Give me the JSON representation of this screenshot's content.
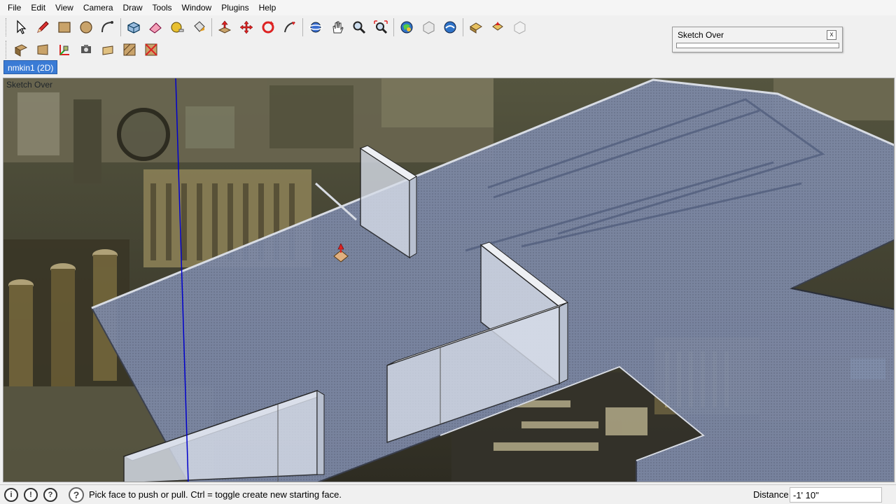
{
  "menu": {
    "items": [
      "File",
      "Edit",
      "View",
      "Camera",
      "Draw",
      "Tools",
      "Window",
      "Plugins",
      "Help"
    ]
  },
  "toolbar1": {
    "groups": [
      [
        "select-tool",
        "pencil-tool",
        "rectangle-tool",
        "circle-tool",
        "arc-tool"
      ],
      [
        "make-component-tool",
        "eraser-tool",
        "tape-measure-tool",
        "paint-bucket-tool"
      ],
      [
        "push-pull-tool",
        "move-tool",
        "rotate-tool",
        "follow-me-tool"
      ],
      [
        "orbit-tool",
        "pan-tool",
        "zoom-tool",
        "zoom-extents-tool"
      ],
      [
        "get-models-tool",
        "share-model-tool",
        "share-component-tool"
      ],
      [
        "walk-tool",
        "look-around-tool",
        "position-camera-tool"
      ]
    ]
  },
  "toolbar2": {
    "items": [
      "position-texture-tool",
      "project-texture-tool",
      "axes-tool",
      "camera-match-tool",
      "plane-tool",
      "hatch-tool",
      "remove-texture-tool"
    ]
  },
  "scene_tab": {
    "label": "nmkin1 (2D)"
  },
  "float_panel": {
    "title": "Sketch Over",
    "close": "x"
  },
  "viewport": {
    "label": "Sketch Over"
  },
  "statusbar": {
    "help": "?",
    "message": "Pick face to push or pull.  Ctrl = toggle create new starting face.",
    "distance_label": "Distance",
    "distance_value": "-1' 10\""
  },
  "colors": {
    "floor": "#7e8aa8",
    "wall": "#d6dce8",
    "accent": "#3a7bd5",
    "axis": "#0000cc"
  }
}
